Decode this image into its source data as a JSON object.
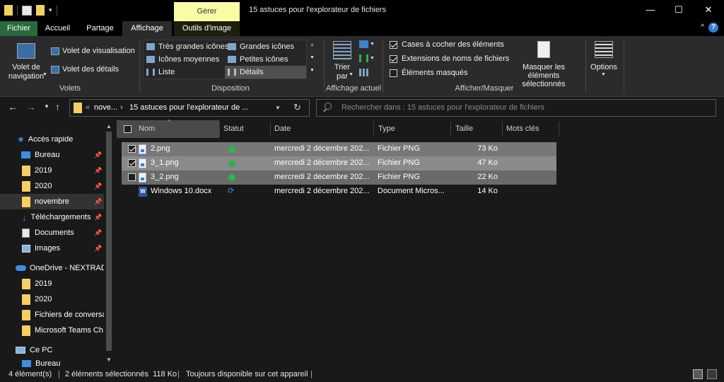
{
  "window": {
    "title": "15 astuces pour l'explorateur de fichiers",
    "contextual_tab_group": "Gérer",
    "minimize_glyph": "—",
    "maximize_glyph": "☐",
    "close_glyph": "✕"
  },
  "tabs": [
    {
      "label": "Fichier"
    },
    {
      "label": "Accueil"
    },
    {
      "label": "Partage"
    },
    {
      "label": "Affichage"
    },
    {
      "label": "Outils d'image"
    }
  ],
  "help_glyph": "?",
  "collapse_glyph": "^",
  "ribbon": {
    "volet_navigation": "Volet de navigation",
    "volet_visualisation": "Volet de visualisation",
    "volet_details": "Volet des détails",
    "group_volets": "Volets",
    "layouts": [
      "Très grandes icônes",
      "Grandes icônes",
      "Icônes moyennes",
      "Petites icônes",
      "Liste",
      "Détails"
    ],
    "group_disposition": "Disposition",
    "trier_par": "Trier par",
    "group_affichage_actuel": "Affichage actuel",
    "cases_a_cocher": "Cases à cocher des éléments",
    "extensions": "Extensions de noms de fichiers",
    "elements_masques": "Éléments masqués",
    "masquer_selection": "Masquer les éléments sélectionnés",
    "group_afficher_masquer": "Afficher/Masquer",
    "options": "Options",
    "checkboxes": {
      "cases_a_cocher": true,
      "extensions": true,
      "elements_masques": false
    }
  },
  "address": {
    "segments": [
      "«",
      "nove...",
      "›",
      "15 astuces pour l'explorateur de ..."
    ],
    "search_placeholder": "Rechercher dans : 15 astuces pour l'explorateur de fichiers"
  },
  "nav": {
    "quick_access": "Accès rapide",
    "quick_items": [
      "Bureau",
      "2019",
      "2020",
      "novembre",
      "Téléchargements",
      "Documents",
      "Images"
    ],
    "onedrive": "OneDrive - NEXTRADI",
    "onedrive_items": [
      "2019",
      "2020",
      "Fichiers de conversa",
      "Microsoft Teams Ch"
    ],
    "this_pc": "Ce PC",
    "this_pc_items": [
      "Bureau"
    ]
  },
  "columns": [
    "Nom",
    "Statut",
    "Date",
    "Type",
    "Taille",
    "Mots clés"
  ],
  "files": [
    {
      "name": "2.png",
      "date": "mercredi 2 décembre 202...",
      "type": "Fichier PNG",
      "size": "73 Ko",
      "selected": true,
      "checked": true,
      "status": "ok"
    },
    {
      "name": "3_1.png",
      "date": "mercredi 2 décembre 202...",
      "type": "Fichier PNG",
      "size": "47 Ko",
      "selected": true,
      "checked": true,
      "status": "ok"
    },
    {
      "name": "3_2.png",
      "date": "mercredi 2 décembre 202...",
      "type": "Fichier PNG",
      "size": "22 Ko",
      "selected": true,
      "checked": false,
      "status": "ok"
    },
    {
      "name": "Windows 10.docx",
      "date": "mercredi 2 décembre 202...",
      "type": "Document Micros...",
      "size": "14 Ko",
      "selected": false,
      "checked": false,
      "status": "sync"
    }
  ],
  "statusbar": {
    "count": "4 élément(s)",
    "selected": "2 éléments sélectionnés  118 Ko",
    "availability": "Toujours disponible sur cet appareil"
  },
  "colors": {
    "file_tab": "#276b3c",
    "manage_tab": "#fbfba6",
    "selection": "#777777",
    "folder": "#f6cf63",
    "status_ok": "#2db34a"
  }
}
